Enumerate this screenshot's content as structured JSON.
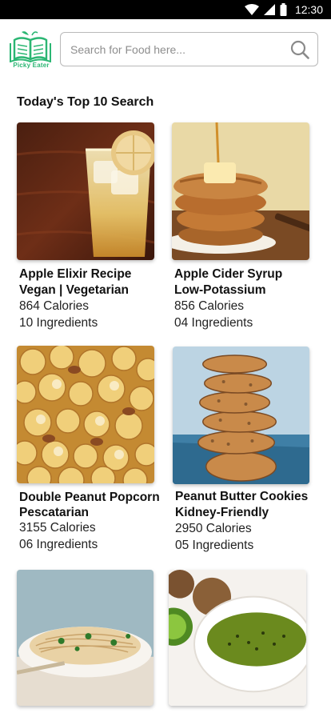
{
  "status_bar": {
    "time": "12:30"
  },
  "app": {
    "logo_text": "Picky Eater"
  },
  "search": {
    "placeholder": "Search for Food here..."
  },
  "section": {
    "title": "Today's Top 10 Search"
  },
  "recipes": [
    {
      "title_line1": "Apple Elixir Recipe",
      "title_line2": "Vegan | Vegetarian",
      "calories": "864 Calories",
      "ingredients": "10 Ingredients",
      "image": "apple-drink"
    },
    {
      "title_line1": "Apple Cider Syrup",
      "title_line2": "Low-Potassium",
      "calories": "856 Calories",
      "ingredients": "04 Ingredients",
      "image": "pancakes"
    },
    {
      "title_line1": "Double Peanut Popcorn",
      "title_line2": "Pescatarian",
      "calories": "3155 Calories",
      "ingredients": "06 Ingredients",
      "image": "popcorn"
    },
    {
      "title_line1": "Peanut Butter Cookies",
      "title_line2": "Kidney-Friendly",
      "calories": "2950 Calories",
      "ingredients": "05 Ingredients",
      "image": "cookies"
    },
    {
      "image": "noodle-salad"
    },
    {
      "image": "kiwi-puree"
    }
  ],
  "colors": {
    "brand": "#2bb673",
    "status_bar": "#000000"
  }
}
